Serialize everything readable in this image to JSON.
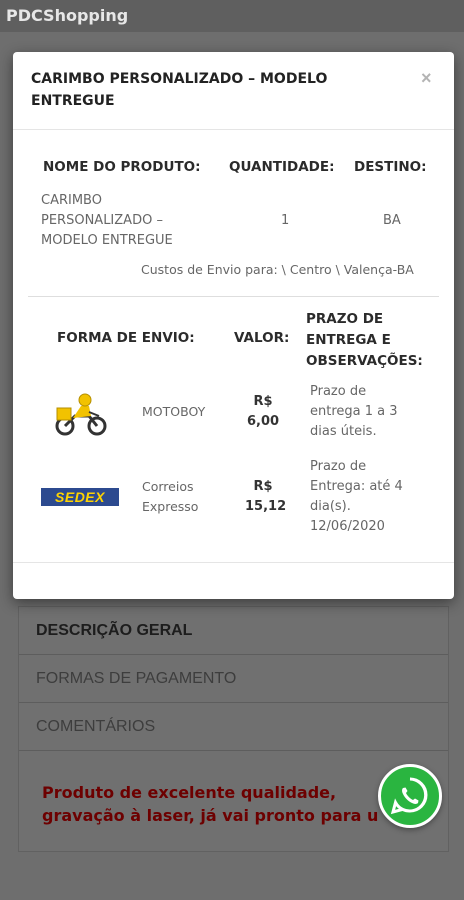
{
  "app": {
    "title": "PDCShopping"
  },
  "modal": {
    "title_line1": "CARIMBO PERSONALIZADO – MODELO",
    "title_line2": "ENTREGUE",
    "close_label": "×",
    "product_table": {
      "headers": [
        "NOME DO PRODUTO:",
        "QUANTIDADE:",
        "DESTINO:"
      ],
      "row": {
        "name_lines": [
          "CARIMBO",
          "PERSONALIZADO –",
          "MODELO ENTREGUE"
        ],
        "quantity": "1",
        "destination": "BA"
      },
      "shipping_costs_text": "Custos de Envio para: \\ Centro \\ Valença-BA"
    },
    "shipping_table": {
      "headers": {
        "method": "FORMA DE ENVIO:",
        "value": "VALOR:",
        "deadline_lines": [
          "PRAZO DE",
          "ENTREGA E",
          "OBSERVAÇÕES:"
        ]
      },
      "rows": [
        {
          "icon": "motoboy-icon",
          "method_lines": [
            "MOTOBOY"
          ],
          "value_lines": [
            "R$",
            "6,00"
          ],
          "deadline_lines": [
            "Prazo de",
            "entrega 1 a 3",
            "dias úteis."
          ]
        },
        {
          "icon": "sedex-logo",
          "logo_text": "SEDEX",
          "method_lines": [
            "Correios",
            "Expresso"
          ],
          "value_lines": [
            "R$",
            "15,12"
          ],
          "deadline_lines": [
            "Prazo de",
            "Entrega: até 4",
            "dia(s).",
            "12/06/2020"
          ]
        }
      ]
    }
  },
  "background": {
    "tabs": [
      "DESCRIÇÃO GERAL",
      "FORMAS DE PAGAMENTO",
      "COMENTÁRIOS"
    ],
    "description_lines": [
      "Produto de excelente qualidade,",
      "gravação à laser, já vai pronto para u"
    ]
  },
  "colors": {
    "accent_description": "#6d0000",
    "whatsapp_green": "#2ab540",
    "sedex_blue": "#2c4a8f",
    "sedex_yellow": "#ffd400"
  }
}
